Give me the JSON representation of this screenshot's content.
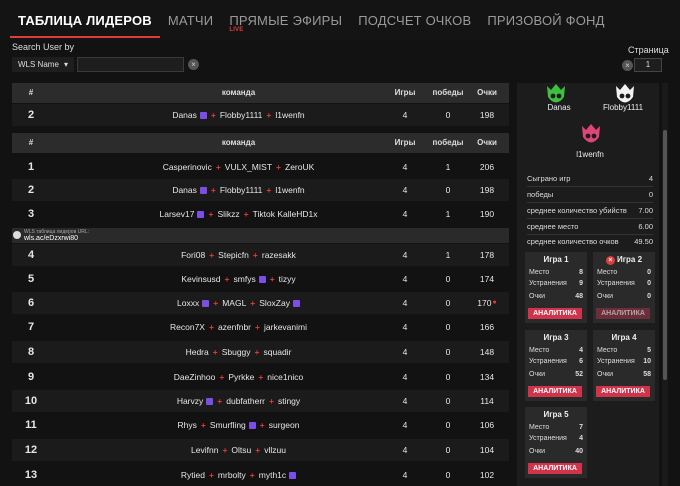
{
  "nav": {
    "tabs": [
      {
        "label": "ТАБЛИЦА ЛИДЕРОВ",
        "active": true
      },
      {
        "label": "МАТЧИ"
      },
      {
        "label": "ПРЯМЫЕ ЭФИРЫ",
        "badge": "LIVE"
      },
      {
        "label": "ПОДСЧЕТ ОЧКОВ"
      },
      {
        "label": "ПРИЗОВОЙ ФОНД"
      }
    ]
  },
  "controls": {
    "search_label": "Search User by",
    "search_by_value": "WLS Name",
    "search_value": "",
    "page_label": "Страница",
    "page_value": "1"
  },
  "table": {
    "headers": {
      "rank": "#",
      "team": "команда",
      "games": "Игры",
      "wins": "победы",
      "points": "Очки"
    },
    "pinned_row": {
      "rank": "2",
      "players": [
        "Danas",
        "Flobby1111",
        "l1wenfn"
      ],
      "twitch": [
        true,
        false,
        false
      ],
      "games": "4",
      "wins": "0",
      "points": "198"
    },
    "rows": [
      {
        "rank": "1",
        "players": [
          "Casperinovic",
          "VULX_MIST",
          "ZeroUK"
        ],
        "twitch": [
          false,
          false,
          false
        ],
        "games": "4",
        "wins": "1",
        "points": "206"
      },
      {
        "rank": "2",
        "players": [
          "Danas",
          "Flobby1111",
          "l1wenfn"
        ],
        "twitch": [
          true,
          false,
          false
        ],
        "games": "4",
        "wins": "0",
        "points": "198"
      },
      {
        "rank": "3",
        "players": [
          "Larsev17",
          "Slikzz",
          "Tiktok KalleHD1x"
        ],
        "twitch": [
          true,
          false,
          false
        ],
        "games": "4",
        "wins": "1",
        "points": "190"
      },
      {
        "rank": "4",
        "players": [
          "Fori08",
          "Stepicfn",
          "razesakk"
        ],
        "twitch": [
          false,
          false,
          false
        ],
        "games": "4",
        "wins": "1",
        "points": "178"
      },
      {
        "rank": "5",
        "players": [
          "Kevinsusd",
          "smfys",
          "tizyy"
        ],
        "twitch": [
          false,
          true,
          false
        ],
        "games": "4",
        "wins": "0",
        "points": "174"
      },
      {
        "rank": "6",
        "players": [
          "Loxxx",
          "MAGL",
          "SloxZay"
        ],
        "twitch": [
          true,
          false,
          true
        ],
        "games": "4",
        "wins": "0",
        "points": "170",
        "dot": true
      },
      {
        "rank": "7",
        "players": [
          "Recon7X",
          "azenfnbr",
          "jarkevanimi"
        ],
        "twitch": [
          false,
          false,
          false
        ],
        "games": "4",
        "wins": "0",
        "points": "166"
      },
      {
        "rank": "8",
        "players": [
          "Hedra",
          "Sbuggy",
          "squadir"
        ],
        "twitch": [
          false,
          false,
          false
        ],
        "games": "4",
        "wins": "0",
        "points": "148"
      },
      {
        "rank": "9",
        "players": [
          "DaeZinhoo",
          "Pyrkke",
          "nice1nico"
        ],
        "twitch": [
          false,
          false,
          false
        ],
        "games": "4",
        "wins": "0",
        "points": "134"
      },
      {
        "rank": "10",
        "players": [
          "Harvzy",
          "dubfatherr",
          "stingy"
        ],
        "twitch": [
          true,
          false,
          false
        ],
        "games": "4",
        "wins": "0",
        "points": "114"
      },
      {
        "rank": "11",
        "players": [
          "Rhys",
          "Smurfling",
          "surgeon"
        ],
        "twitch": [
          false,
          true,
          false
        ],
        "games": "4",
        "wins": "0",
        "points": "106"
      },
      {
        "rank": "12",
        "players": [
          "Levifnn",
          "Oltsu",
          "vllzuu"
        ],
        "twitch": [
          false,
          false,
          false
        ],
        "games": "4",
        "wins": "0",
        "points": "104"
      },
      {
        "rank": "13",
        "players": [
          "Rytied",
          "mrbolty",
          "myth1c"
        ],
        "twitch": [
          false,
          false,
          true
        ],
        "games": "4",
        "wins": "0",
        "points": "102"
      }
    ],
    "url_bar": {
      "label": "WLS таблица лидеров URL:",
      "url": "wls.ac/eDzxrwi80"
    }
  },
  "panel": {
    "members": [
      {
        "name": "Danas",
        "color": "#3fbf3f"
      },
      {
        "name": "Flobby1111",
        "color": "#f2f2f2"
      },
      {
        "name": "l1wenfn",
        "color": "#e0457a"
      }
    ],
    "stats": [
      {
        "label": "Сыграно игр",
        "value": "4"
      },
      {
        "label": "победы",
        "value": "0"
      },
      {
        "label": "среднее количество убийств",
        "value": "7.00"
      },
      {
        "label": "среднее место",
        "value": "6.00"
      },
      {
        "label": "среднее количество очков",
        "value": "49.50"
      }
    ],
    "games": [
      {
        "title": "Игра 1",
        "place_label": "Место",
        "place": "8",
        "elims_label": "Устранения",
        "elims": "9",
        "points_label": "Очки",
        "points": "48",
        "button": "АНАЛИТИКА",
        "missed": false
      },
      {
        "title": "Игра 2",
        "place_label": "Место",
        "place": "0",
        "elims_label": "Устранения",
        "elims": "0",
        "points_label": "Очки",
        "points": "0",
        "button": "АНАЛИТИКА",
        "missed": true
      },
      {
        "title": "Игра 3",
        "place_label": "Место",
        "place": "4",
        "elims_label": "Устранения",
        "elims": "6",
        "points_label": "Очки",
        "points": "52",
        "button": "АНАЛИТИКА",
        "missed": false
      },
      {
        "title": "Игра 4",
        "place_label": "Место",
        "place": "5",
        "elims_label": "Устранения",
        "elims": "10",
        "points_label": "Очки",
        "points": "58",
        "button": "АНАЛИТИКА",
        "missed": false
      },
      {
        "title": "Игра 5",
        "place_label": "Место",
        "place": "7",
        "elims_label": "Устранения",
        "elims": "4",
        "points_label": "Очки",
        "points": "40",
        "button": "АНАЛИТИКА",
        "missed": false
      }
    ]
  },
  "colors": {
    "accent": "#e03c3c",
    "button": "#d0344a",
    "twitch": "#7d4ee6"
  }
}
